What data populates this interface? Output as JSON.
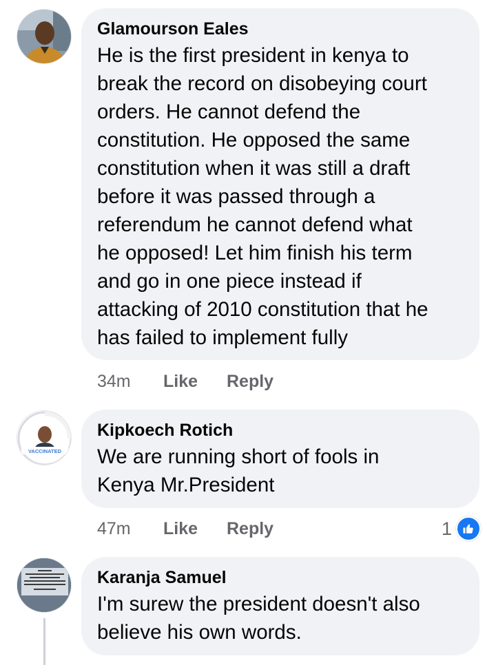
{
  "comments": [
    {
      "author": "Glamourson Eales",
      "text": "He is the first president in kenya to\nbreak the record on disobeying court\norders. He cannot defend the\nconstitution. He opposed the same\nconstitution when it was still a draft\nbefore it was passed through a\nreferendum he cannot defend what\nhe opposed! Let him finish his term\nand go in one piece instead if\nattacking of 2010 constitution that he\nhas failed to implement fully",
      "time": "34m",
      "like_label": "Like",
      "reply_label": "Reply"
    },
    {
      "author": "Kipkoech Rotich",
      "text": "We are running short of fools in\nKenya Mr.President",
      "time": "47m",
      "like_label": "Like",
      "reply_label": "Reply",
      "reaction_count": "1",
      "avatar_badge": "VACCINATED"
    },
    {
      "author": "Karanja Samuel",
      "text": "I'm surew the president doesn't also\nbelieve his own words.",
      "avatar_text": "I LOVE THE LORD FOR HE HEARD MY VOICE; HE HEARD MY CRY FOR MERCY. BECAUSE HE TURNED HIS EAR TO ME, I WILL CALL ON HIM AS LONG AS I LIVE."
    }
  ],
  "colors": {
    "bubble": "#f0f2f5",
    "text": "#050505",
    "meta": "#65676b",
    "like_blue": "#1877f2"
  },
  "icons": {
    "reaction": "thumbs-up-icon"
  }
}
